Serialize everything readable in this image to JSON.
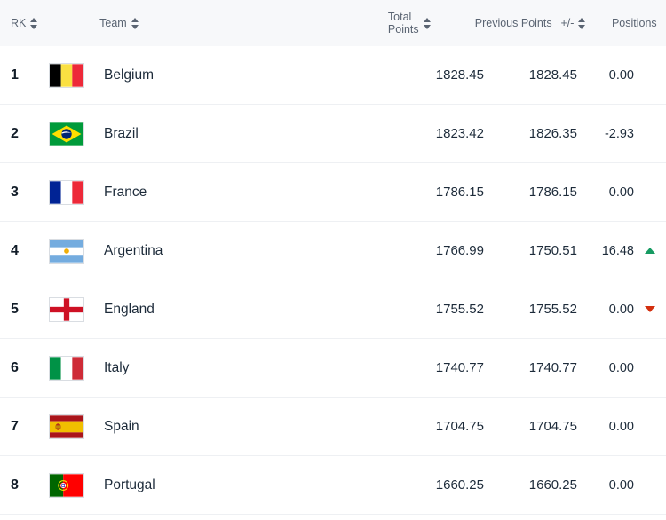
{
  "table": {
    "columns": [
      {
        "key": "rk",
        "label": "RK",
        "sortable": true,
        "sort_icon": "sort-arrows-icon"
      },
      {
        "key": "team",
        "label": "Team",
        "sortable": true,
        "sort_icon": "sort-arrows-icon"
      },
      {
        "key": "total",
        "label": "Total\nPoints",
        "sortable": true,
        "sort_icon": "sort-arrows-icon"
      },
      {
        "key": "previous",
        "label": "Previous Points",
        "sortable": false,
        "sort_icon": ""
      },
      {
        "key": "diff",
        "label": "+/-",
        "sortable": true,
        "sort_icon": "sort-arrows-icon"
      },
      {
        "key": "positions",
        "label": "Positions",
        "sortable": false,
        "sort_icon": ""
      }
    ],
    "rows": [
      {
        "rank": "1",
        "team": "Belgium",
        "flag": "flag-belgium",
        "total_points": "1828.45",
        "previous_points": "1828.45",
        "diff": "0.00",
        "movement": "none"
      },
      {
        "rank": "2",
        "team": "Brazil",
        "flag": "flag-brazil",
        "total_points": "1823.42",
        "previous_points": "1826.35",
        "diff": "-2.93",
        "movement": "none"
      },
      {
        "rank": "3",
        "team": "France",
        "flag": "flag-france",
        "total_points": "1786.15",
        "previous_points": "1786.15",
        "diff": "0.00",
        "movement": "none"
      },
      {
        "rank": "4",
        "team": "Argentina",
        "flag": "flag-argentina",
        "total_points": "1766.99",
        "previous_points": "1750.51",
        "diff": "16.48",
        "movement": "up"
      },
      {
        "rank": "5",
        "team": "England",
        "flag": "flag-england",
        "total_points": "1755.52",
        "previous_points": "1755.52",
        "diff": "0.00",
        "movement": "down"
      },
      {
        "rank": "6",
        "team": "Italy",
        "flag": "flag-italy",
        "total_points": "1740.77",
        "previous_points": "1740.77",
        "diff": "0.00",
        "movement": "none"
      },
      {
        "rank": "7",
        "team": "Spain",
        "flag": "flag-spain",
        "total_points": "1704.75",
        "previous_points": "1704.75",
        "diff": "0.00",
        "movement": "none"
      },
      {
        "rank": "8",
        "team": "Portugal",
        "flag": "flag-portugal",
        "total_points": "1660.25",
        "previous_points": "1660.25",
        "diff": "0.00",
        "movement": "none"
      }
    ]
  },
  "colors": {
    "header_background": "#f7f8fa",
    "row_background": "#ffffff",
    "row_divider": "#eef0f3",
    "text_primary": "#1d2b3a",
    "text_header": "#5a6472",
    "movement_up": "#169b62",
    "movement_down": "#d32f0e"
  }
}
